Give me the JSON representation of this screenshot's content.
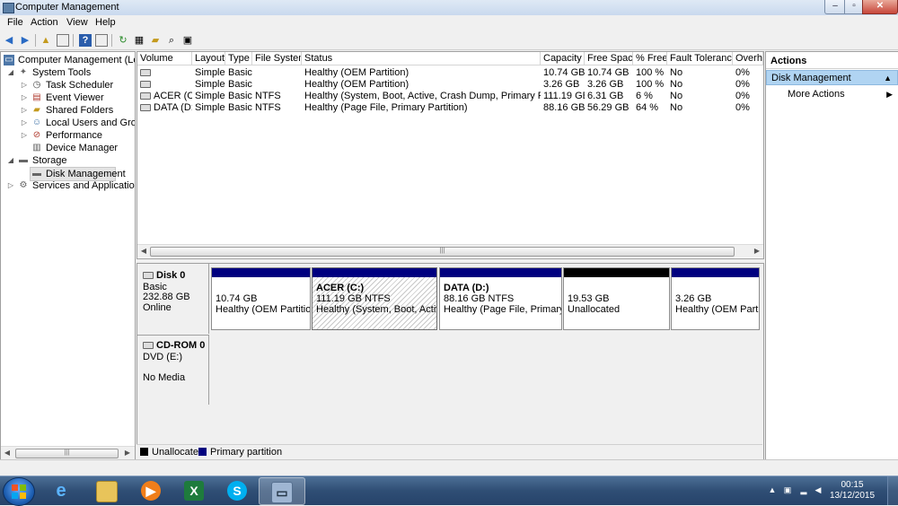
{
  "window": {
    "title": "Computer Management",
    "close_glyph": "✕",
    "max_glyph": "▫",
    "min_glyph": "–"
  },
  "menu": [
    "File",
    "Action",
    "View",
    "Help"
  ],
  "tree": {
    "root": "Computer Management (Local",
    "system_tools": "System Tools",
    "task_scheduler": "Task Scheduler",
    "event_viewer": "Event Viewer",
    "shared_folders": "Shared Folders",
    "local_users": "Local Users and Groups",
    "performance": "Performance",
    "device_manager": "Device Manager",
    "storage": "Storage",
    "disk_management": "Disk Management",
    "services": "Services and Applications"
  },
  "table": {
    "columns": [
      "Volume",
      "Layout",
      "Type",
      "File System",
      "Status",
      "Capacity",
      "Free Space",
      "% Free",
      "Fault Tolerance",
      "Overhe"
    ],
    "rows": [
      [
        "",
        "Simple",
        "Basic",
        "",
        "Healthy (OEM Partition)",
        "10.74 GB",
        "10.74 GB",
        "100 %",
        "No",
        "0%"
      ],
      [
        "",
        "Simple",
        "Basic",
        "",
        "Healthy (OEM Partition)",
        "3.26 GB",
        "3.26 GB",
        "100 %",
        "No",
        "0%"
      ],
      [
        "ACER (C:)",
        "Simple",
        "Basic",
        "NTFS",
        "Healthy (System, Boot, Active, Crash Dump, Primary Partition)",
        "111.19 GB",
        "6.31 GB",
        "6 %",
        "No",
        "0%"
      ],
      [
        "DATA (D:)",
        "Simple",
        "Basic",
        "NTFS",
        "Healthy (Page File, Primary Partition)",
        "88.16 GB",
        "56.29 GB",
        "64 %",
        "No",
        "0%"
      ]
    ]
  },
  "disks": {
    "disk0": {
      "name": "Disk 0",
      "type": "Basic",
      "size": "232.88 GB",
      "state": "Online",
      "partitions": [
        {
          "title": "",
          "size": "10.74 GB",
          "status": "Healthy (OEM Partition)"
        },
        {
          "title": "ACER  (C:)",
          "size": "111.19 GB NTFS",
          "status": "Healthy (System, Boot, Active, C"
        },
        {
          "title": "DATA  (D:)",
          "size": "88.16 GB NTFS",
          "status": "Healthy (Page File, Primary Par"
        },
        {
          "title": "",
          "size": "19.53 GB",
          "status": "Unallocated"
        },
        {
          "title": "",
          "size": "3.26 GB",
          "status": "Healthy (OEM Partitic"
        }
      ]
    },
    "cdrom0": {
      "name": "CD-ROM 0",
      "drive": "DVD (E:)",
      "media": "No Media"
    }
  },
  "legend": {
    "unallocated": "Unallocated",
    "primary": "Primary partition"
  },
  "actions": {
    "header": "Actions",
    "section": "Disk Management",
    "more": "More Actions"
  },
  "taskbar": {
    "time": "00:15",
    "date": "13/12/2015",
    "excel_glyph": "X",
    "skype_glyph": "S"
  },
  "colors": {
    "primary": "#00007f",
    "unallocated": "#000000",
    "selection": "#b0d4f2"
  }
}
